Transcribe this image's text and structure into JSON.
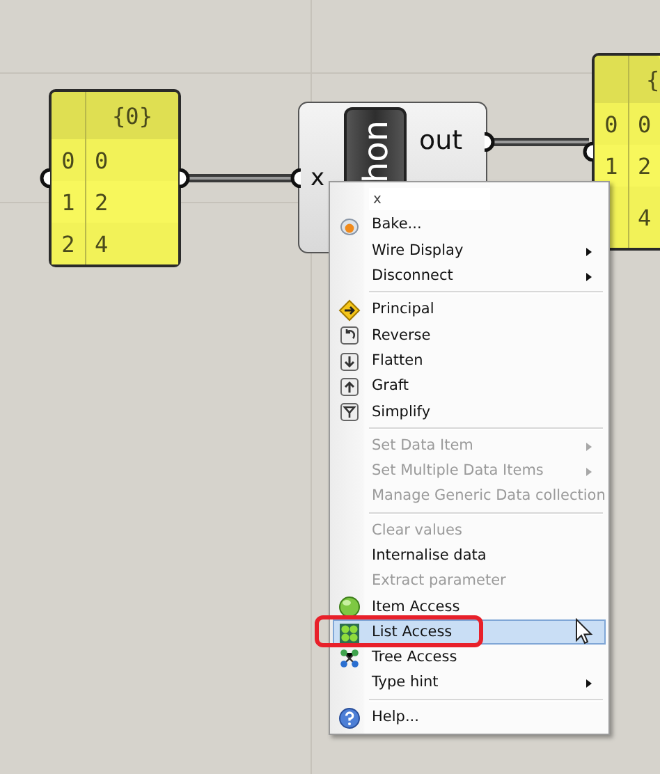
{
  "canvas": {
    "panels": [
      {
        "header": "{0}",
        "rows": [
          {
            "index": "0",
            "value": "0"
          },
          {
            "index": "1",
            "value": "2"
          },
          {
            "index": "2",
            "value": "4"
          }
        ]
      },
      {
        "header": "{",
        "rows": [
          {
            "index": "0",
            "value": "0"
          },
          {
            "index": "1",
            "value": "2"
          },
          {
            "value": "4"
          }
        ]
      }
    ],
    "component": {
      "label": "hon",
      "inputs": [
        "x"
      ],
      "outputs": [
        "out"
      ]
    }
  },
  "context_menu": {
    "items": [
      {
        "kind": "field",
        "value": "x"
      },
      {
        "kind": "item",
        "label": "Bake...",
        "disabled": false,
        "submenu": false,
        "selected": false
      },
      {
        "kind": "item",
        "label": "Wire Display",
        "disabled": false,
        "submenu": true,
        "selected": false
      },
      {
        "kind": "item",
        "label": "Disconnect",
        "disabled": false,
        "submenu": true,
        "selected": false
      },
      {
        "kind": "separator"
      },
      {
        "kind": "item",
        "label": "Principal",
        "disabled": false,
        "submenu": false,
        "selected": false
      },
      {
        "kind": "item",
        "label": "Reverse",
        "disabled": false,
        "submenu": false,
        "selected": false
      },
      {
        "kind": "item",
        "label": "Flatten",
        "disabled": false,
        "submenu": false,
        "selected": false
      },
      {
        "kind": "item",
        "label": "Graft",
        "disabled": false,
        "submenu": false,
        "selected": false
      },
      {
        "kind": "item",
        "label": "Simplify",
        "disabled": false,
        "submenu": false,
        "selected": false
      },
      {
        "kind": "separator"
      },
      {
        "kind": "item",
        "label": "Set Data Item",
        "disabled": true,
        "submenu": true,
        "selected": false
      },
      {
        "kind": "item",
        "label": "Set Multiple Data Items",
        "disabled": true,
        "submenu": true,
        "selected": false
      },
      {
        "kind": "item",
        "label": "Manage Generic Data collection",
        "disabled": true,
        "submenu": false,
        "selected": false
      },
      {
        "kind": "separator"
      },
      {
        "kind": "item",
        "label": "Clear values",
        "disabled": true,
        "submenu": false,
        "selected": false
      },
      {
        "kind": "item",
        "label": "Internalise data",
        "disabled": false,
        "submenu": false,
        "selected": false
      },
      {
        "kind": "item",
        "label": "Extract parameter",
        "disabled": true,
        "submenu": false,
        "selected": false
      },
      {
        "kind": "item",
        "label": "Item Access",
        "disabled": false,
        "submenu": false,
        "selected": false
      },
      {
        "kind": "item",
        "label": "List Access",
        "disabled": false,
        "submenu": false,
        "selected": true
      },
      {
        "kind": "item",
        "label": "Tree Access",
        "disabled": false,
        "submenu": false,
        "selected": false
      },
      {
        "kind": "item",
        "label": "Type hint",
        "disabled": false,
        "submenu": true,
        "selected": false
      },
      {
        "kind": "separator"
      },
      {
        "kind": "item",
        "label": "Help...",
        "disabled": false,
        "submenu": false,
        "selected": false
      }
    ]
  }
}
